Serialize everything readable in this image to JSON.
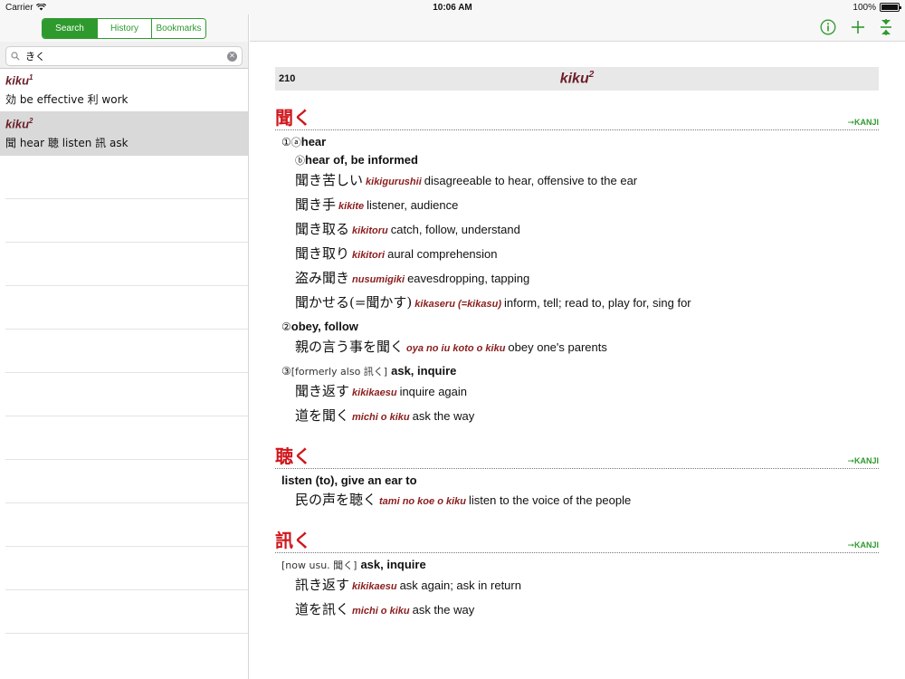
{
  "status_bar": {
    "carrier": "Carrier",
    "time": "10:06 AM",
    "battery": "100%",
    "battery_level": 1.0
  },
  "segments": [
    {
      "label": "Search",
      "active": true
    },
    {
      "label": "History",
      "active": false
    },
    {
      "label": "Bookmarks",
      "active": false
    }
  ],
  "search": {
    "value": "きく",
    "placeholder": ""
  },
  "results": [
    {
      "word": "kiku",
      "sup": "1",
      "gloss": "効 be effective 利 work",
      "selected": false
    },
    {
      "word": "kiku",
      "sup": "2",
      "gloss": "聞 hear 聴 listen 訊 ask",
      "selected": true
    }
  ],
  "entry": {
    "page": "210",
    "headword": "kiku",
    "headword_sup": "2",
    "kanji_link_label": "➞KANJI",
    "sections": [
      {
        "kanji": "聞く",
        "senses": [
          {
            "num": "①",
            "mark": "ⓐ",
            "note": "",
            "text": "hear",
            "indent": 1
          },
          {
            "num": "",
            "mark": "ⓑ",
            "note": "",
            "text": "hear of, be informed",
            "indent": 2
          },
          {
            "ex": true,
            "jp": "聞き苦しい",
            "rom": "kikigurushii",
            "en": "disagreeable to hear, offensive to the ear"
          },
          {
            "ex": true,
            "jp": "聞き手",
            "rom": "kikite",
            "en": "listener, audience"
          },
          {
            "ex": true,
            "jp": "聞き取る",
            "rom": "kikitoru",
            "en": "catch, follow, understand"
          },
          {
            "ex": true,
            "jp": "聞き取り",
            "rom": "kikitori",
            "en": "aural comprehension"
          },
          {
            "ex": true,
            "jp": "盗み聞き",
            "rom": "nusumigiki",
            "en": "eavesdropping, tapping"
          },
          {
            "ex": true,
            "jp": "聞かせる(=聞かす)",
            "rom": "kikaseru (=kikasu)",
            "en": "inform, tell; read to, play for, sing for"
          },
          {
            "num": "②",
            "mark": "",
            "note": "",
            "text": "obey, follow",
            "indent": 1
          },
          {
            "ex": true,
            "jp": "親の言う事を聞く",
            "rom": "oya no iu koto o kiku",
            "en": "obey one's parents"
          },
          {
            "num": "③",
            "mark": "",
            "note": "[formerly also 訊く]",
            "text": "ask, inquire",
            "indent": 1
          },
          {
            "ex": true,
            "jp": "聞き返す",
            "rom": "kikikaesu",
            "en": "inquire again"
          },
          {
            "ex": true,
            "jp": "道を聞く",
            "rom": "michi o kiku",
            "en": "ask the way"
          }
        ]
      },
      {
        "kanji": "聴く",
        "senses": [
          {
            "num": "",
            "mark": "",
            "note": "",
            "text": "listen (to), give an ear to",
            "indent": 0
          },
          {
            "ex": true,
            "jp": "民の声を聴く",
            "rom": "tami no koe o kiku",
            "en": "listen to the voice of the people"
          }
        ]
      },
      {
        "kanji": "訊く",
        "senses": [
          {
            "num": "",
            "mark": "",
            "note": "[now usu. 聞く]",
            "text": "ask, inquire",
            "indent": 0
          },
          {
            "ex": true,
            "jp": "訊き返す",
            "rom": "kikikaesu",
            "en": "ask again; ask in return"
          },
          {
            "ex": true,
            "jp": "道を訊く",
            "rom": "michi o kiku",
            "en": "ask the way"
          }
        ]
      }
    ]
  },
  "colors": {
    "accent": "#2e9a2e",
    "headword": "#6b1f2a",
    "kanji": "#d0161c",
    "romaji": "#8b1d1d"
  },
  "icons": [
    "wifi-icon",
    "magnifier-icon",
    "clear-icon",
    "info-icon",
    "plus-icon",
    "collapse-icon"
  ]
}
